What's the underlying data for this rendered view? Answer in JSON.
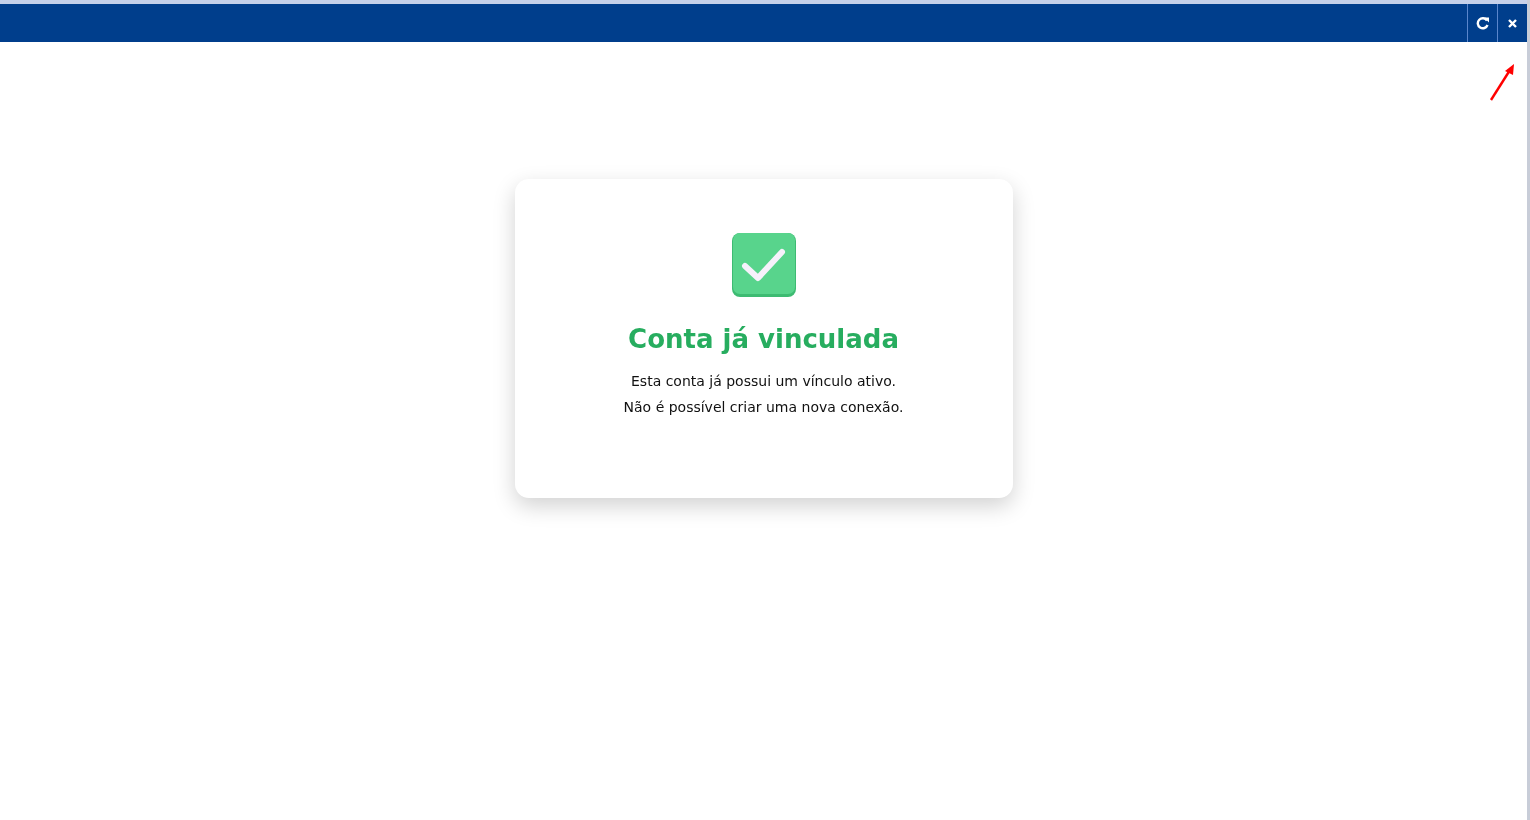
{
  "dialog": {
    "title": "Conta já vinculada",
    "message": [
      "Esta conta já possui um vínculo ativo.",
      "Não é possível criar uma nova conexão."
    ]
  },
  "toolbar": {
    "buttons": [
      {
        "kind": "refresh"
      },
      {
        "kind": "close"
      }
    ]
  }
}
